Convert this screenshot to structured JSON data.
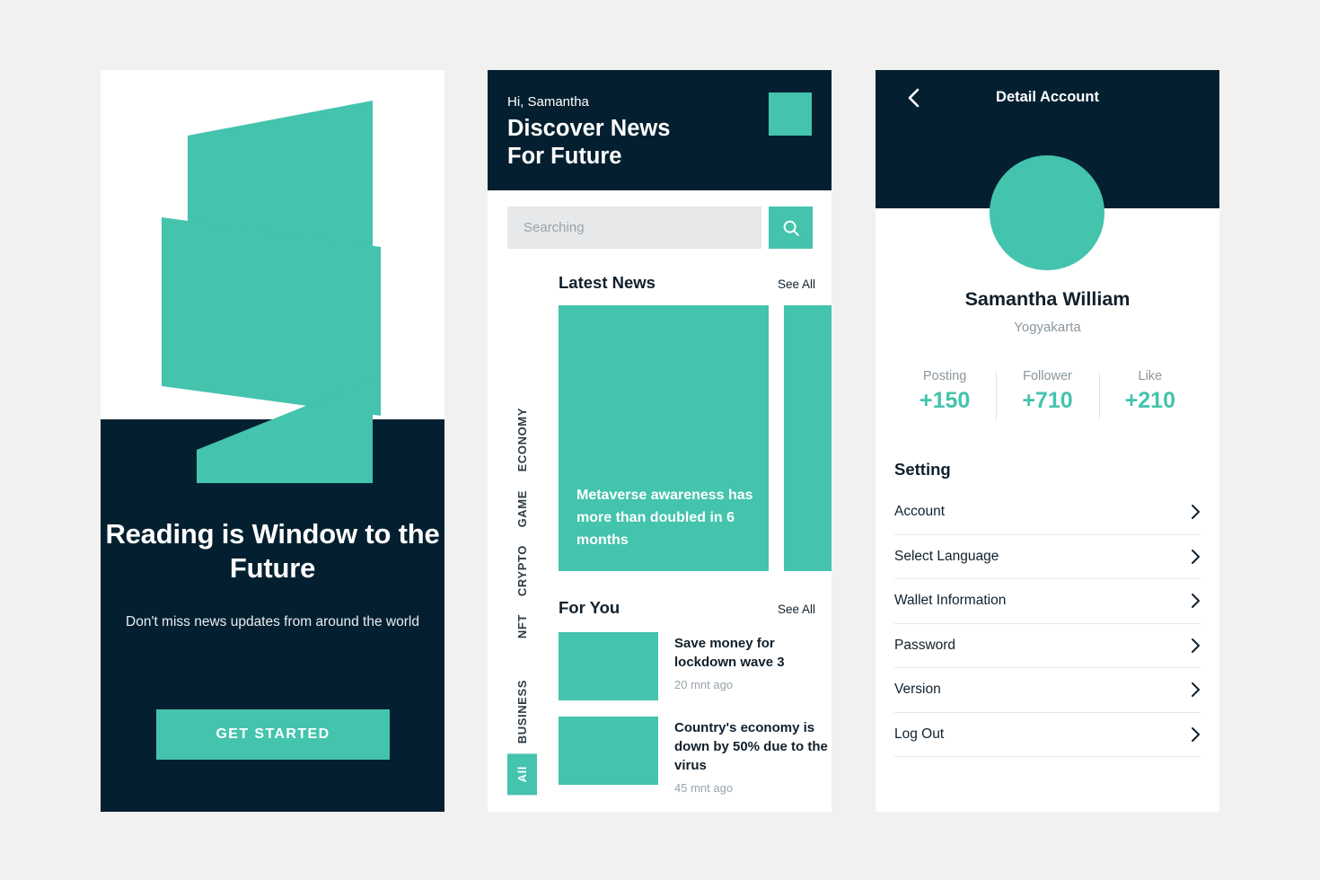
{
  "theme": {
    "accent": "#44c3ad",
    "dark": "#042030",
    "page_bg": "#f1f1f1",
    "card_bg": "#ffffff",
    "muted_text": "#8b969e",
    "search_bg": "#e6e8ea"
  },
  "onboarding": {
    "logo_icon": "zigzag-brand-logo",
    "headline": "Reading is Window to the Future",
    "subheadline": "Don't miss news updates from around the world",
    "cta_label": "GET STARTED"
  },
  "discover": {
    "greeting": "Hi, Samantha",
    "title": "Discover News For Future",
    "avatar_icon": "avatar-square",
    "search": {
      "placeholder": "Searching",
      "value": "",
      "button_icon": "search-icon"
    },
    "categories": [
      {
        "label": "ECONOMY",
        "active": false
      },
      {
        "label": "GAME",
        "active": false
      },
      {
        "label": "CRYPTO",
        "active": false
      },
      {
        "label": "NFT",
        "active": false
      },
      {
        "label": "BUSINESS",
        "active": false
      },
      {
        "label": "All",
        "active": true
      }
    ],
    "latest": {
      "title": "Latest News",
      "see_all": "See All",
      "featured": {
        "headline": "Metaverse awareness has more than doubled in 6 months",
        "image_icon": "article-thumbnail"
      },
      "next_card_icon": "article-thumbnail-partial"
    },
    "for_you": {
      "title": "For You",
      "see_all": "See All",
      "items": [
        {
          "title": "Save money for lockdown wave 3",
          "time": "20 mnt ago",
          "image_icon": "article-thumbnail"
        },
        {
          "title": "Country's economy is down by 50% due to the virus",
          "time": "45 mnt ago",
          "image_icon": "article-thumbnail"
        }
      ]
    }
  },
  "account": {
    "back_icon": "chevron-left-icon",
    "title": "Detail Account",
    "avatar_icon": "avatar-circle",
    "name": "Samantha William",
    "location": "Yogyakarta",
    "stats": [
      {
        "label": "Posting",
        "value": "+150"
      },
      {
        "label": "Follower",
        "value": "+710"
      },
      {
        "label": "Like",
        "value": "+210"
      }
    ],
    "setting_heading": "Setting",
    "setting_items": [
      {
        "label": "Account",
        "chevron_icon": "chevron-right-icon"
      },
      {
        "label": "Select Language",
        "chevron_icon": "chevron-right-icon"
      },
      {
        "label": "Wallet Information",
        "chevron_icon": "chevron-right-icon"
      },
      {
        "label": "Password",
        "chevron_icon": "chevron-right-icon"
      },
      {
        "label": "Version",
        "chevron_icon": "chevron-right-icon"
      },
      {
        "label": "Log Out",
        "chevron_icon": "chevron-right-icon"
      }
    ]
  }
}
